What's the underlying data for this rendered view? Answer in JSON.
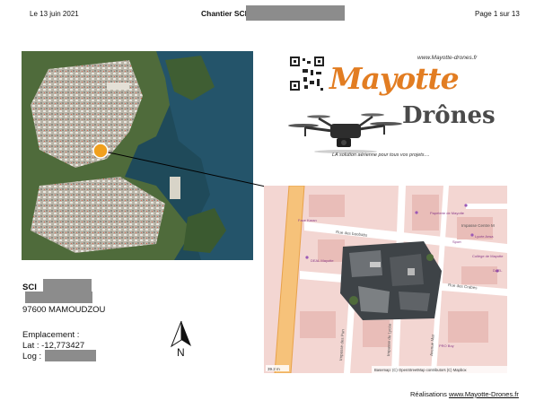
{
  "header": {
    "date": "Le 13 juin 2021",
    "title": "Chantier SCI",
    "page": "Page 1 sur 13"
  },
  "logo": {
    "url": "www.Mayotte-drones.fr",
    "brand_line1": "Mayotte",
    "brand_line2": "Drônes",
    "tagline": "LA solution aérienne pour tous vos projets...."
  },
  "map": {
    "streets": [
      "Rue des baobabs",
      "Rue des Crabes",
      "Impasse Centre M",
      "Impasse des Pun",
      "Impasse du Lycée",
      "Avenue Mar"
    ],
    "pois": [
      "Face Karan",
      "DEAL Mayotte",
      "Papeterie de Mayotte",
      "Lycée Ansa",
      "Sport",
      "Collège de Mayotte",
      "DAEL",
      "PRO Boy"
    ],
    "scale": "39.2 m",
    "attribution": "Basemap: (C) OpenStreetMap contributors (C) Mapbox"
  },
  "address": {
    "name": "SCI",
    "city": "97600 MAMOUDZOU",
    "location_label": "Emplacement :",
    "lat": "Lat : -12,773427",
    "log": "Log :"
  },
  "compass": {
    "label": "N"
  },
  "footer": {
    "prefix": "Réalisations",
    "link": "www.Mayotte-Drones.fr"
  }
}
